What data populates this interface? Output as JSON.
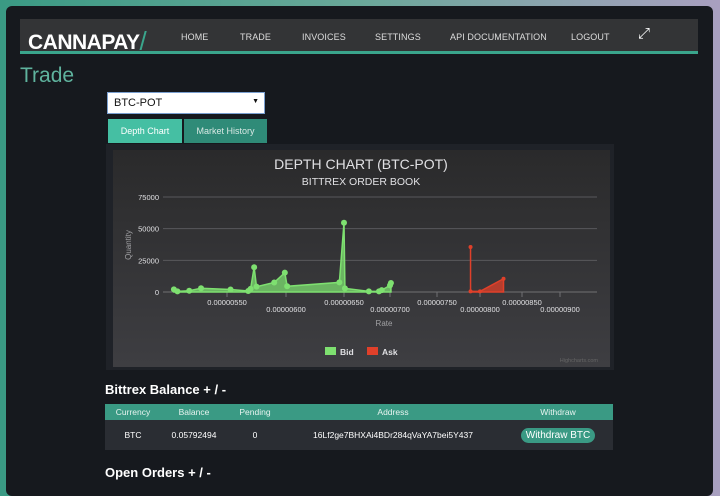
{
  "nav": {
    "logo": "CANNAPAY",
    "items": [
      "HOME",
      "TRADE",
      "INVOICES",
      "SETTINGS",
      "API DOCUMENTATION",
      "LOGOUT"
    ],
    "expand_icon": "expand-arrows-icon"
  },
  "page": {
    "title": "Trade"
  },
  "pair_select": {
    "value": "BTC-POT"
  },
  "tabs": [
    "Depth Chart",
    "Market History"
  ],
  "chart_data": {
    "type": "area",
    "title": "DEPTH CHART (BTC-POT)",
    "subtitle": "BITTREX ORDER BOOK",
    "xlabel": "Rate",
    "ylabel": "Quantity",
    "yticks": [
      "0",
      "25000",
      "50000",
      "75000"
    ],
    "ylim": [
      0,
      75000
    ],
    "xticks": [
      "0.00000550",
      "0.00000600",
      "0.00000650",
      "0.00000700",
      "0.00000750",
      "0.00000800",
      "0.00000850",
      "0.00000900"
    ],
    "grid": true,
    "legend": "bottom-center",
    "credit": "Highcharts.com",
    "colors": {
      "Bid": "#7ee070",
      "Ask": "#e0402a"
    },
    "series": [
      {
        "name": "Bid",
        "points": [
          [
            5.05e-06,
            2100
          ],
          [
            5.08e-06,
            500
          ],
          [
            5.18e-06,
            1000
          ],
          [
            5.28e-06,
            3000
          ],
          [
            5.53e-06,
            2000
          ],
          [
            5.68e-06,
            800
          ],
          [
            5.7e-06,
            2500
          ],
          [
            5.73e-06,
            19500
          ],
          [
            5.75e-06,
            4200
          ],
          [
            5.9e-06,
            7500
          ],
          [
            5.99e-06,
            15300
          ],
          [
            6.01e-06,
            4500
          ],
          [
            6.46e-06,
            7600
          ],
          [
            6.5e-06,
            54700
          ],
          [
            6.51e-06,
            2900
          ],
          [
            6.77e-06,
            500
          ],
          [
            6.88e-06,
            500
          ],
          [
            6.91e-06,
            1500
          ],
          [
            7e-06,
            5200
          ],
          [
            7.01e-06,
            7100
          ]
        ]
      },
      {
        "name": "Ask",
        "points": [
          [
            7.89e-06,
            35500
          ],
          [
            7.89e-06,
            500
          ],
          [
            8e-06,
            500
          ],
          [
            8.28e-06,
            10500
          ]
        ]
      }
    ]
  },
  "balance": {
    "title": "Bittrex Balance + / -",
    "headers": [
      "Currency",
      "Balance",
      "Pending",
      "Address",
      "Withdraw"
    ],
    "rows": [
      {
        "currency": "BTC",
        "balance": "0.05792494",
        "pending": "0",
        "address": "16Lf2ge7BHXAi4BDr284qVaYA7bei5Y437",
        "button": "Withdraw BTC"
      }
    ]
  },
  "orders": {
    "title": "Open Orders + / -"
  }
}
